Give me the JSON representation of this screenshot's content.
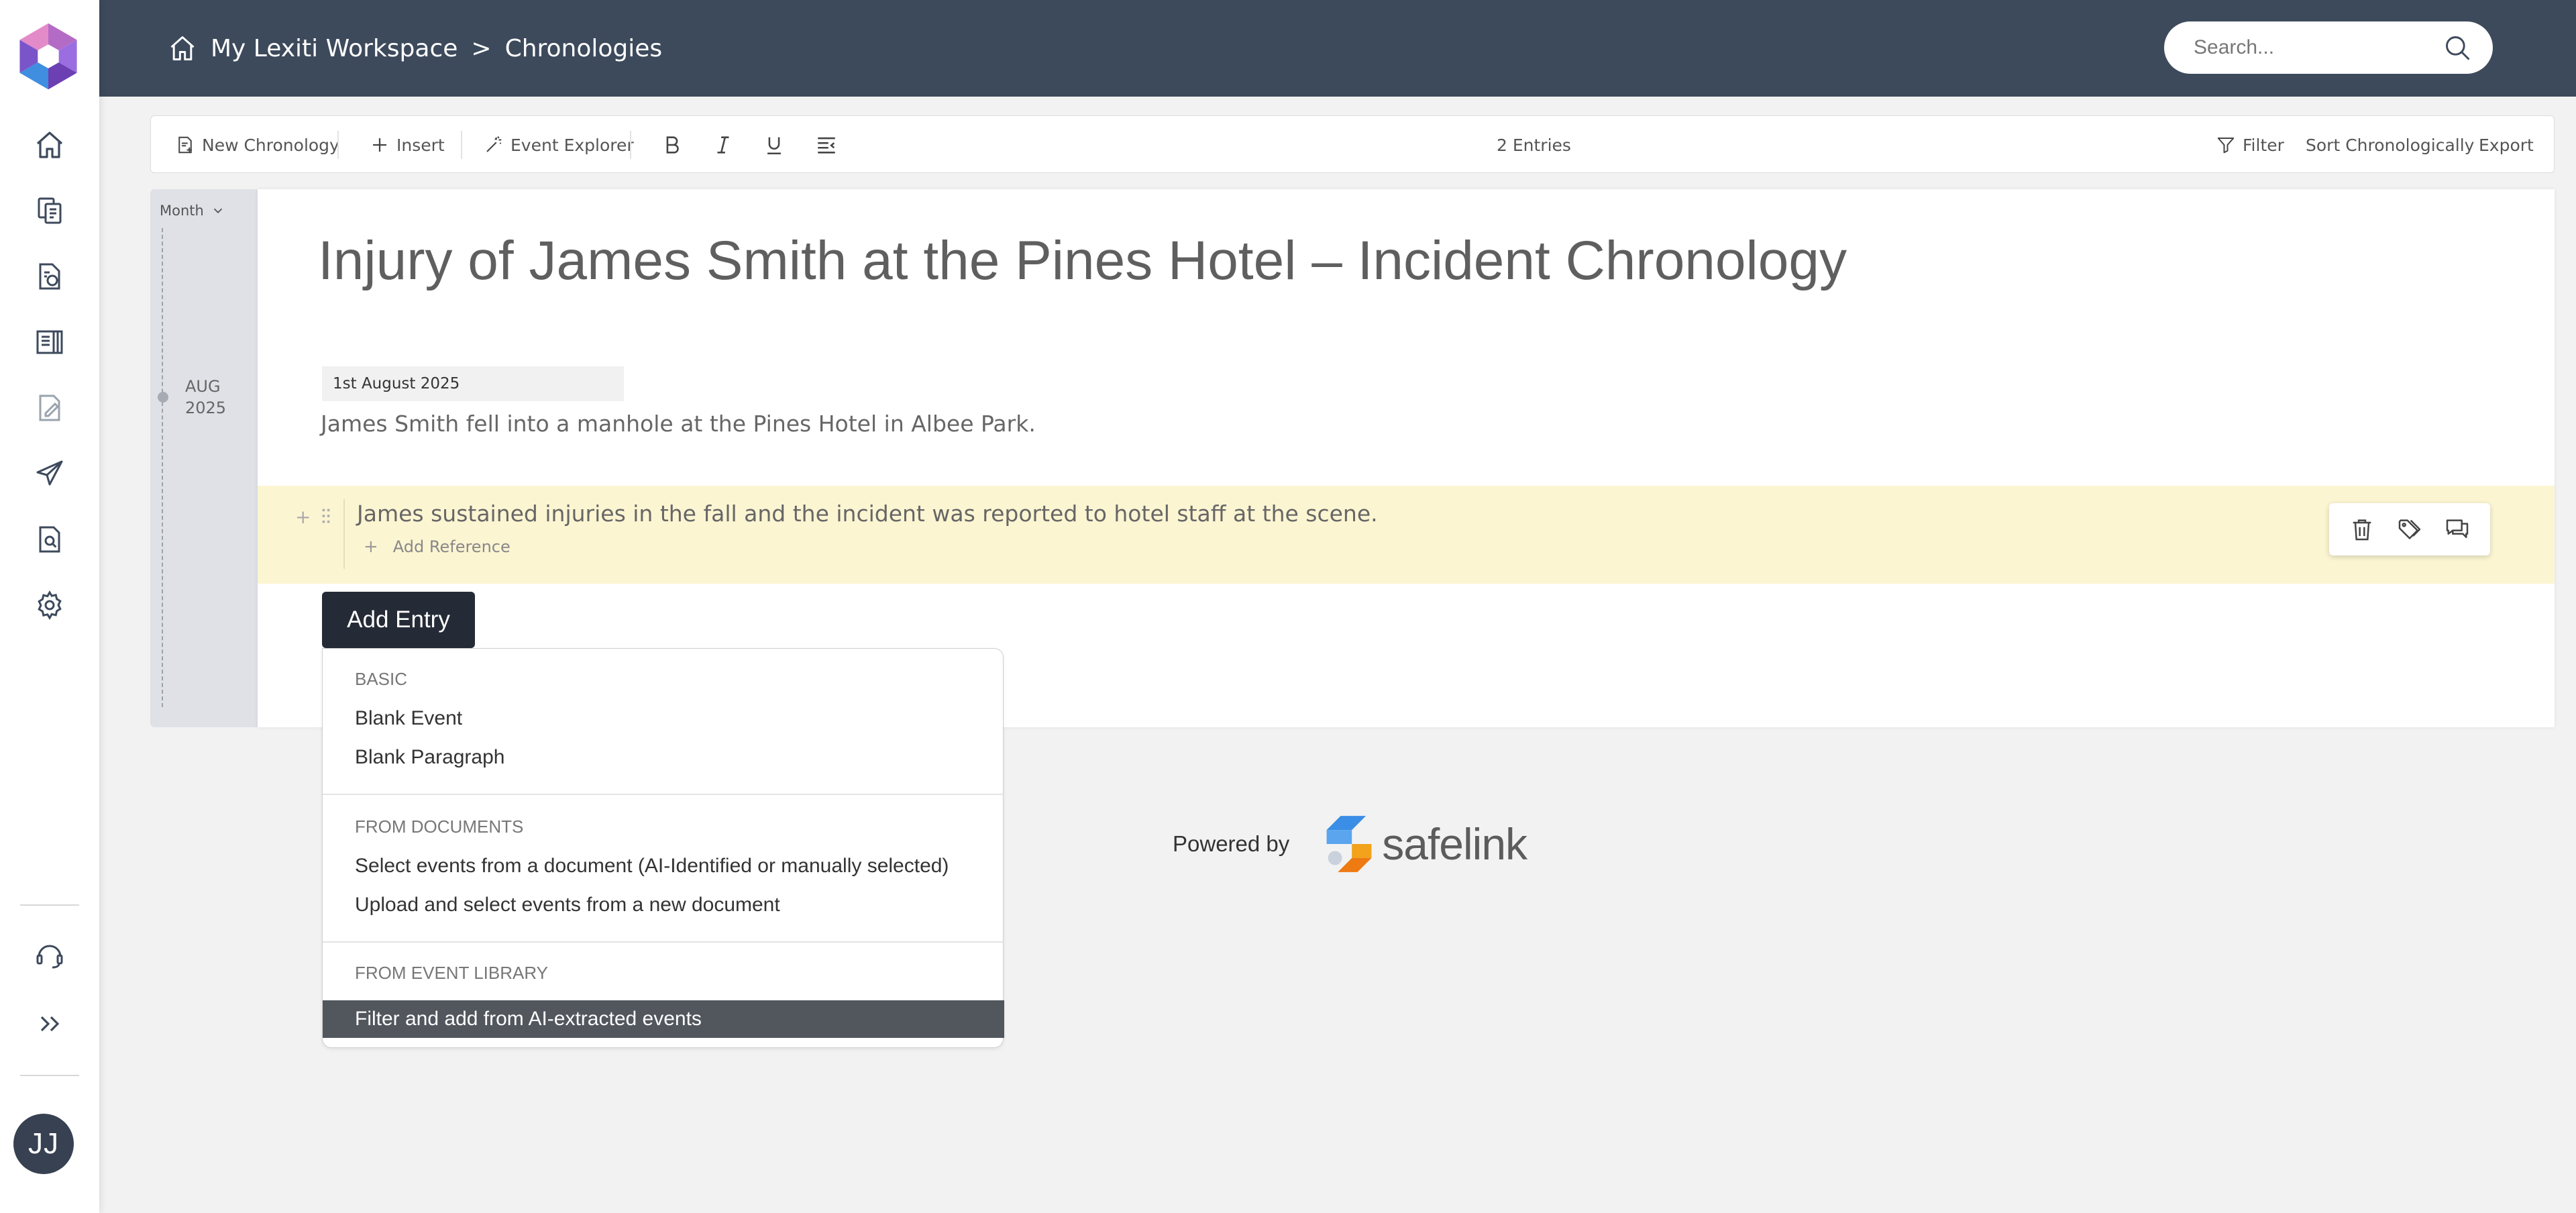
{
  "header": {
    "breadcrumb": [
      "My Lexiti Workspace",
      "Chronologies"
    ],
    "separator": ">",
    "search_placeholder": "Search..."
  },
  "rail": {
    "items": [
      "home-icon",
      "documents-icon",
      "reports-icon",
      "library-icon",
      "edit-document-icon",
      "send-icon",
      "document-search-icon",
      "settings-icon"
    ],
    "bottom_items": [
      "support-icon",
      "expand-icon"
    ],
    "avatar_initials": "JJ"
  },
  "toolbar": {
    "new_chronology": "New Chronology",
    "insert": "Insert",
    "event_explorer": "Event Explorer",
    "entries_count": "2 Entries",
    "filter": "Filter",
    "sort": "Sort Chronologically",
    "export": "Export"
  },
  "timeline": {
    "granularity": "Month",
    "groups": [
      {
        "month": "AUG",
        "year": "2025"
      }
    ]
  },
  "document": {
    "title": "Injury of James Smith at the Pines Hotel – Incident Chronology",
    "entries": [
      {
        "date": "1st August 2025",
        "text": "James Smith fell into a manhole at the Pines Hotel in Albee Park."
      },
      {
        "text": "James sustained injuries in the fall and the incident was reported to hotel staff at the scene.",
        "add_reference": "Add Reference"
      }
    ],
    "add_entry_label": "Add Entry"
  },
  "add_entry_menu": {
    "sections": [
      {
        "heading": "BASIC",
        "items": [
          "Blank Event",
          "Blank Paragraph"
        ]
      },
      {
        "heading": "FROM DOCUMENTS",
        "items": [
          "Select events from a document (AI-Identified or manually selected)",
          "Upload and select events from a new document"
        ]
      },
      {
        "heading": "FROM EVENT LIBRARY",
        "items": [
          "Filter and add from AI-extracted events"
        ]
      }
    ],
    "highlighted_item": "Filter and add from AI-extracted events"
  },
  "footer": {
    "powered_by": "Powered by",
    "brand": "safelink"
  },
  "colors": {
    "header_bg": "#3d4a5c",
    "highlight_entry_bg": "#fcf5d2",
    "add_entry_bg": "#252b36",
    "menu_active_bg": "#52565d"
  }
}
